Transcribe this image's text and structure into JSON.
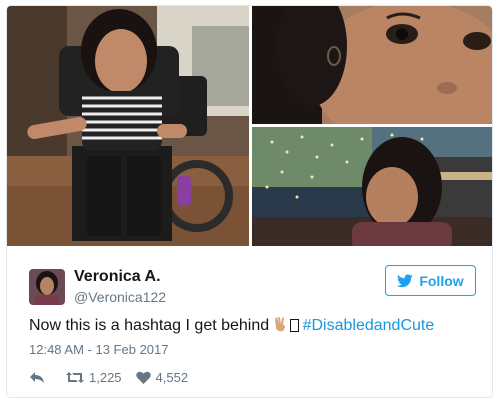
{
  "tweet": {
    "display_name": "Veronica A.",
    "handle": "@Veronica122",
    "follow_label": "Follow",
    "text_before": "Now this is a hashtag I get behind ",
    "hashtag": "#DisabledandCute",
    "timestamp": "12:48 AM - 13 Feb 2017",
    "retweets": "1,225",
    "likes": "4,552"
  },
  "media": {
    "photos": [
      "wheelchair-selfie",
      "closeup-face",
      "night-lights-selfie"
    ]
  },
  "icons": [
    "reply-icon",
    "retweet-icon",
    "heart-icon",
    "bird-icon",
    "peace-hand-icon"
  ],
  "colors": {
    "accent": "#1da1f2",
    "hashtag": "#1b95e0",
    "text": "#14171a",
    "muted": "#657786"
  }
}
